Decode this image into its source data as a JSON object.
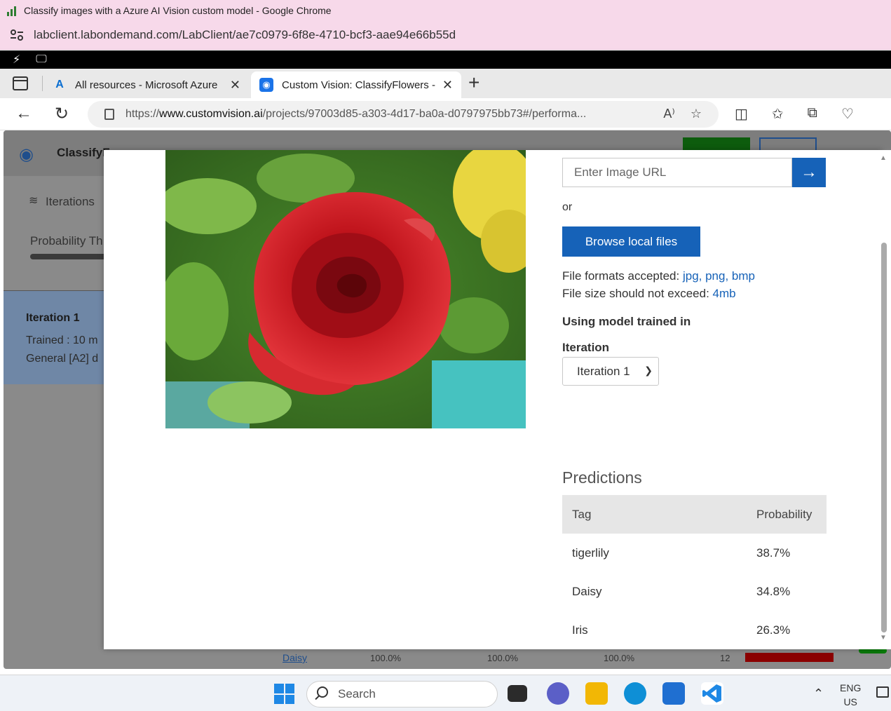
{
  "browser": {
    "window_title": "Classify images with a Azure AI Vision custom model - Google Chrome",
    "lab_url": "labclient.labondemand.com/LabClient/ae7c0979-6f8e-4710-bcf3-aae94e66b55d"
  },
  "edge": {
    "tabs": [
      {
        "label": "All resources - Microsoft Azure",
        "icon": "azure-icon"
      },
      {
        "label": "Custom Vision: ClassifyFlowers -",
        "icon": "custom-vision-icon"
      }
    ],
    "address": {
      "scheme": "https://",
      "host": "www.customvision.ai",
      "path": "/projects/97003d85-a303-4d17-ba0a-d0797975bb73#/performa..."
    }
  },
  "app_background": {
    "project_name": "ClassifyF",
    "sidebar": {
      "iterations_label": "Iterations",
      "probability_label": "Probability Th",
      "iteration_card": {
        "title": "Iteration 1",
        "trained": "Trained : 10 m",
        "domain": "General [A2] d"
      }
    },
    "bottom_row": {
      "tag": "Daisy",
      "precision": "100.0%",
      "recall": "100.0%",
      "ap": "100.0%",
      "image_count": "12"
    }
  },
  "quick_test": {
    "url_placeholder": "Enter Image URL",
    "or_text": "or",
    "browse_label": "Browse local files",
    "formats_prefix": "File formats accepted: ",
    "formats": "jpg, png, bmp",
    "size_prefix": "File size should not exceed: ",
    "size_limit": "4mb",
    "model_heading": "Using model trained in",
    "iteration_label": "Iteration",
    "iteration_selected": "Iteration 1",
    "predictions_title": "Predictions",
    "table_headers": {
      "tag": "Tag",
      "probability": "Probability"
    },
    "predictions": [
      {
        "tag": "tigerlily",
        "probability": "38.7%"
      },
      {
        "tag": "Daisy",
        "probability": "34.8%"
      },
      {
        "tag": "Iris",
        "probability": "26.3%"
      }
    ]
  },
  "taskbar": {
    "search_label": "Search",
    "lang_top": "ENG",
    "lang_bottom": "US"
  },
  "colors": {
    "accent_blue": "#1662b8",
    "title_bar_pink": "#f7d9ea"
  }
}
